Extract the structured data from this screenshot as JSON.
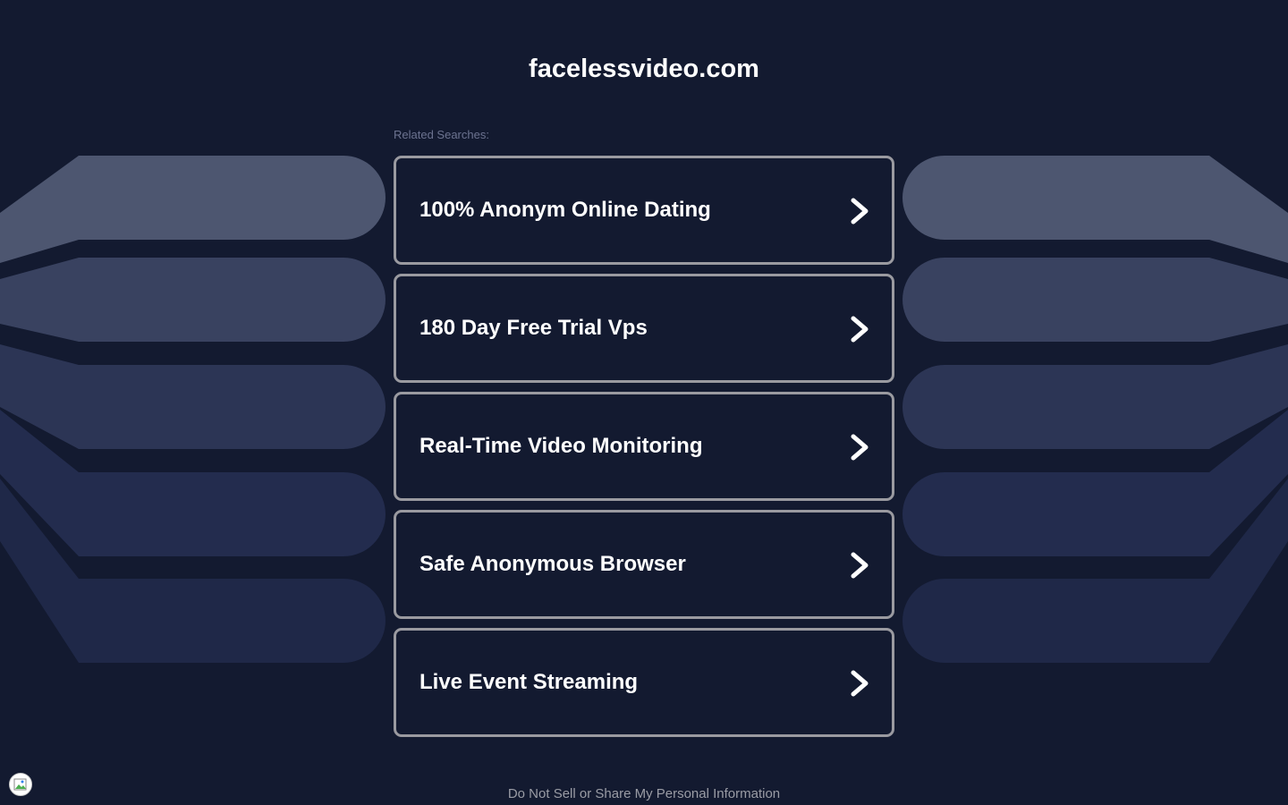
{
  "site": {
    "domain": "facelessvideo.com"
  },
  "related": {
    "label": "Related Searches:",
    "items": [
      {
        "label": "100% Anonym Online Dating",
        "icon": "chevron-right-icon"
      },
      {
        "label": "180 Day Free Trial Vps",
        "icon": "chevron-right-icon"
      },
      {
        "label": "Real-Time Video Monitoring",
        "icon": "chevron-right-icon"
      },
      {
        "label": "Safe Anonymous Browser",
        "icon": "chevron-right-icon"
      },
      {
        "label": "Live Event Streaming",
        "icon": "chevron-right-icon"
      }
    ]
  },
  "footer": {
    "privacy_link": "Do Not Sell or Share My Personal Information"
  },
  "colors": {
    "background": "#131a30",
    "card_border": "#9a9aa0",
    "text": "#ffffff",
    "muted_text": "#6c7390"
  }
}
